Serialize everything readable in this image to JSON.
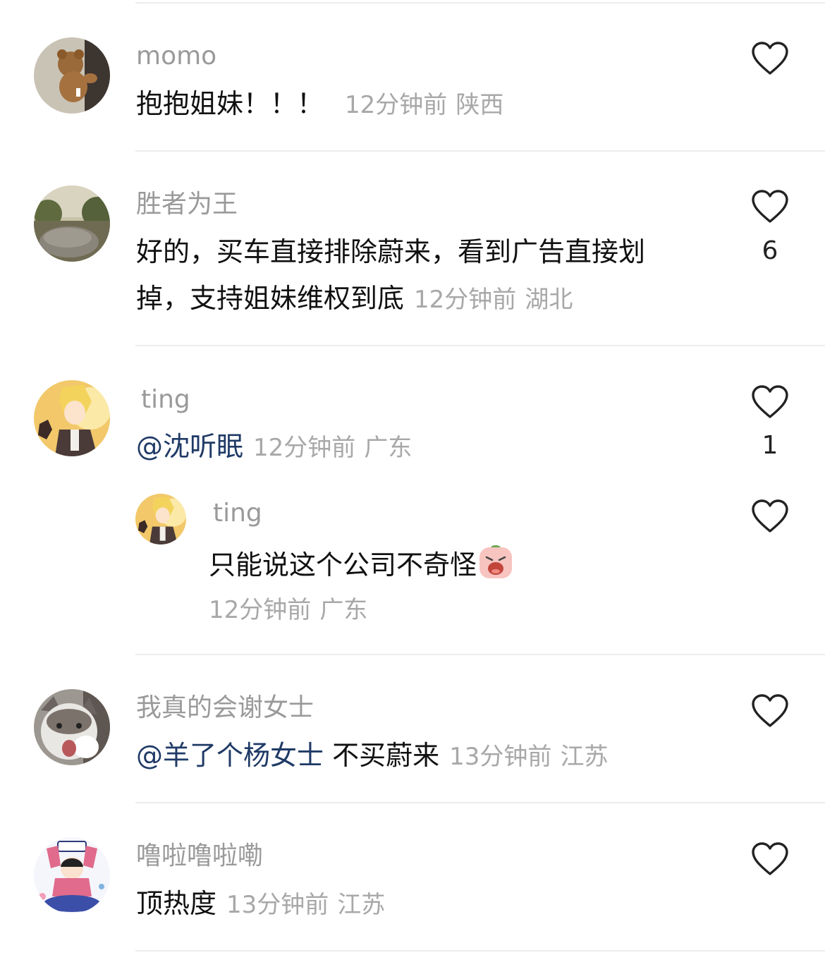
{
  "comments": [
    {
      "username": "momo",
      "text": "抱抱姐妹！！！",
      "time": "12分钟前",
      "location": "陕西"
    },
    {
      "username": "胜者为王",
      "text_line1": "好的，买车直接排除蔚来，看到广告直接划",
      "text_line2": "掉，支持姐妹维权到底",
      "time": "12分钟前",
      "location": "湖北",
      "likes": "6"
    },
    {
      "username": "ting",
      "mention": "@沈听眠",
      "time": "12分钟前",
      "location": "广东",
      "likes": "1",
      "reply": {
        "username": "ting",
        "text": "只能说这个公司不奇怪",
        "time": "12分钟前",
        "location": "广东"
      }
    },
    {
      "username": "我真的会谢女士",
      "mention": "@羊了个杨女士",
      "text": " 不买蔚来",
      "time": "13分钟前",
      "location": "江苏"
    },
    {
      "username": "噜啦噜啦嘞",
      "text": "顶热度",
      "time": "13分钟前",
      "location": "江苏"
    }
  ]
}
